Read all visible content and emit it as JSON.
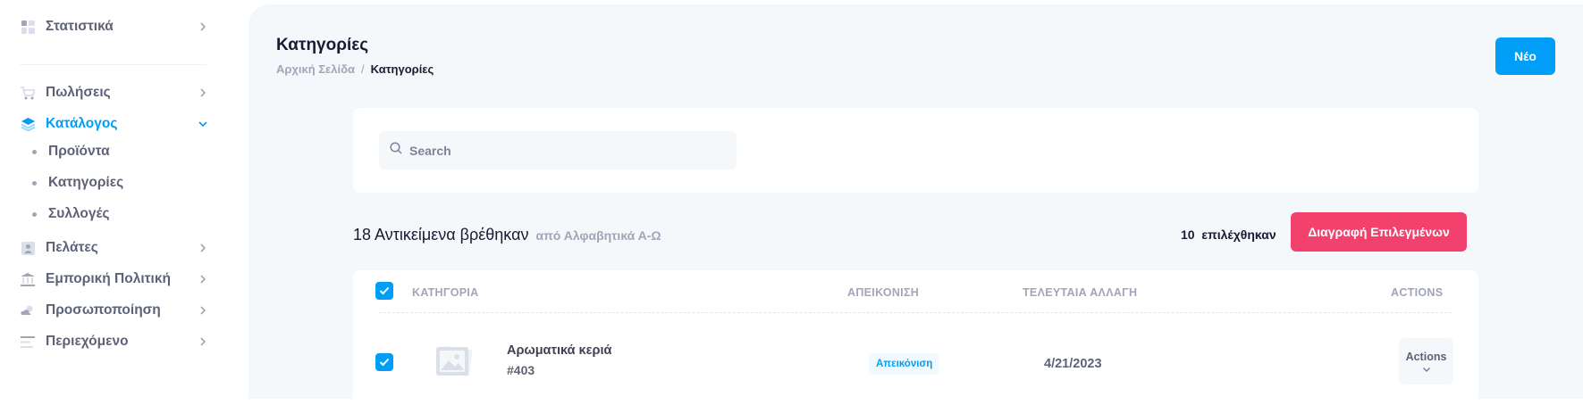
{
  "sidebar": {
    "items": [
      {
        "label": "Στατιστικά",
        "icon": "dashboard-icon"
      },
      {
        "label": "Πωλήσεις",
        "icon": "cart-icon"
      },
      {
        "label": "Κατάλογος",
        "icon": "layers-icon",
        "active": true
      },
      {
        "label": "Πελάτες",
        "icon": "contacts-icon"
      },
      {
        "label": "Εμπορική Πολιτική",
        "icon": "bank-icon"
      },
      {
        "label": "Προσωποποίηση",
        "icon": "weather-icon"
      },
      {
        "label": "Περιεχόμενο",
        "icon": "text-align-icon"
      }
    ],
    "catalog_subitems": [
      "Προϊόντα",
      "Κατηγορίες",
      "Συλλογές"
    ]
  },
  "header": {
    "title": "Κατηγορίες",
    "breadcrumb": {
      "home": "Αρχική Σελίδα",
      "separator": "/",
      "current": "Κατηγορίες"
    },
    "new_button": "Νέο"
  },
  "search": {
    "placeholder": "Search"
  },
  "results": {
    "count_text": "18 Αντικείμενα βρέθηκαν",
    "sort_text": "από Αλφαβητικά Α-Ω",
    "selected_text": "10  επιλέχθηκαν",
    "delete_button": "Διαγραφή Επιλεγμένων"
  },
  "table": {
    "headers": [
      "ΚΑΤΗΓΟΡΙΑ",
      "ΑΠΕΙΚΟΝΙΣΗ",
      "ΤΕΛΕΥΤΑΙΑ ΑΛΛΑΓΗ",
      "ACTIONS"
    ],
    "rows": [
      {
        "name": "Αρωματικά κεριά",
        "id": "#403",
        "badge": "Απεικόνιση",
        "date": "4/21/2023",
        "actions": "Actions",
        "checked": true
      }
    ]
  },
  "colors": {
    "primary": "#009ef7",
    "danger": "#f1416c",
    "muted": "#a1a5b7",
    "background": "#f5f8fa"
  }
}
